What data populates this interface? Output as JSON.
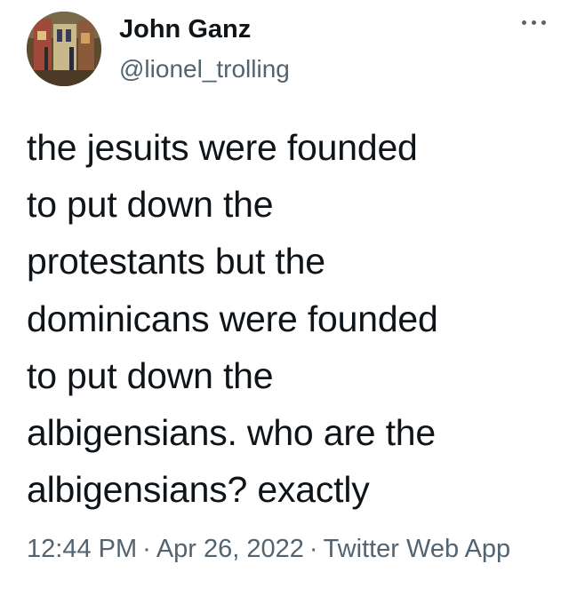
{
  "tweet": {
    "author": {
      "name": "John Ganz",
      "handle": "@lionel_trolling"
    },
    "more_icon": "more-horizontal-icon",
    "text_lines": [
      "the jesuits were founded",
      "to put down the",
      "protestants but the",
      "dominicans were founded",
      "to put down the",
      "albigensians. who are the",
      "albigensians? exactly"
    ],
    "meta": {
      "time": "12:44 PM",
      "separator": "·",
      "date": "Apr 26, 2022",
      "source": "Twitter Web App"
    }
  },
  "colors": {
    "text": "#0f1419",
    "secondary": "#536471",
    "background": "#ffffff"
  }
}
